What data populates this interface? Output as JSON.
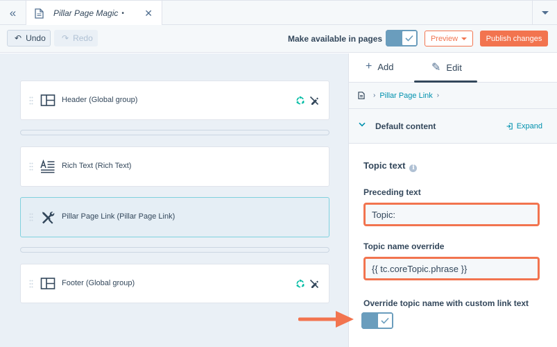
{
  "tabbar": {
    "collapse_glyph": "«",
    "file_tab": {
      "title": "Pillar Page Magic",
      "unsaved_marker": "•",
      "close_glyph": "✕"
    }
  },
  "toolbar": {
    "undo_label": "Undo",
    "redo_label": "Redo",
    "make_available_label": "Make available in pages",
    "make_available_on": true,
    "preview_label": "Preview",
    "publish_label": "Publish changes"
  },
  "canvas": {
    "modules": [
      {
        "label": "Header (Global group)",
        "icon": "layout-icon",
        "global": true,
        "selected": false
      },
      {
        "label": "Rich Text (Rich Text)",
        "icon": "rich-text-icon",
        "global": false,
        "selected": false
      },
      {
        "label": "Pillar Page Link (Pillar Page Link)",
        "icon": "wrench-icon",
        "global": false,
        "selected": true
      },
      {
        "label": "Footer (Global group)",
        "icon": "layout-icon",
        "global": true,
        "selected": false
      }
    ]
  },
  "panel": {
    "tabs": [
      {
        "label": "Add",
        "icon": "plus-icon",
        "active": false
      },
      {
        "label": "Edit",
        "icon": "pencil-icon",
        "active": true
      }
    ],
    "breadcrumb": {
      "item": "Pillar Page Link"
    },
    "section": {
      "title": "Default content",
      "expand_label": "Expand"
    },
    "group_title": "Topic text",
    "fields": {
      "preceding_text": {
        "label": "Preceding text",
        "value": "Topic:"
      },
      "topic_name_override": {
        "label": "Topic name override",
        "value": "{{ tc.coreTopic.phrase }}"
      },
      "override_toggle": {
        "label": "Override topic name with custom link text",
        "on": true
      }
    }
  },
  "colors": {
    "accent_orange": "#f2744f",
    "toggle_on": "#6a9dbd",
    "link": "#0091ae",
    "text": "#33475b",
    "canvas_bg": "#eaf0f6"
  }
}
